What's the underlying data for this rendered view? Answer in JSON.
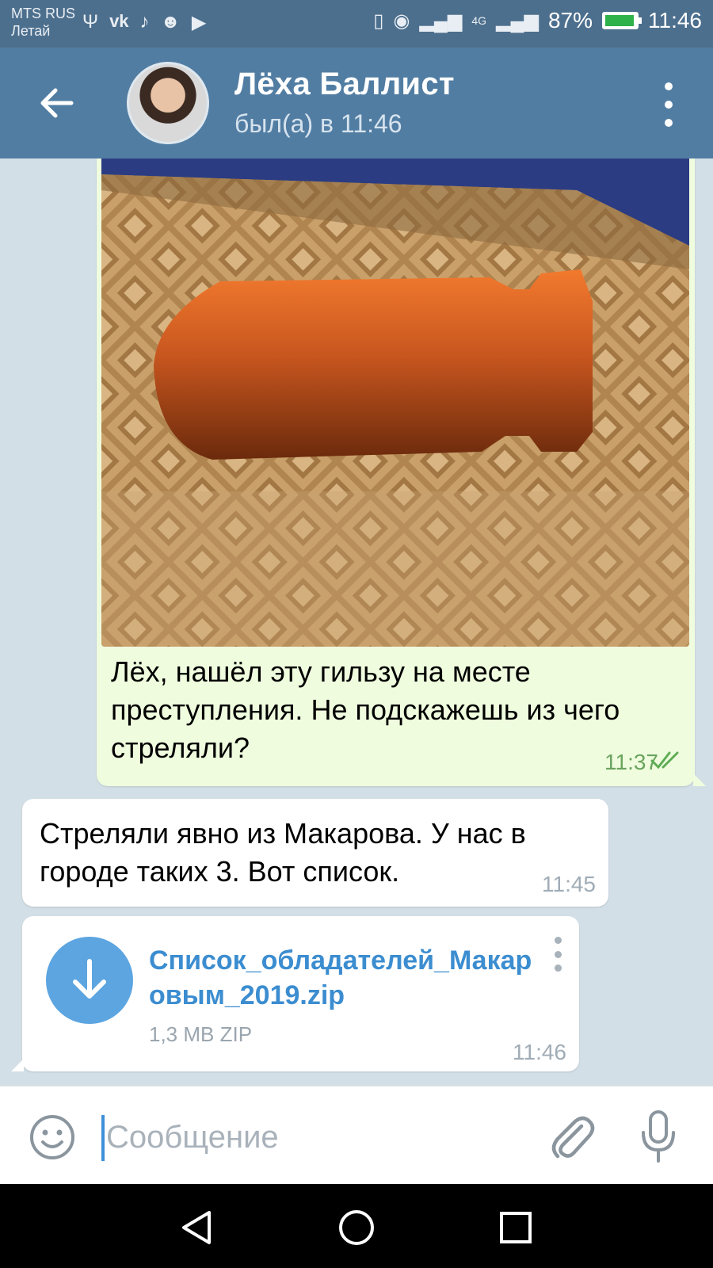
{
  "status_bar": {
    "carrier": "MTS RUS",
    "carrier_sub": "Летай",
    "battery": "87%",
    "time": "11:46",
    "network": "4G"
  },
  "header": {
    "title": "Лёха Баллист",
    "subtitle": "был(а) в 11:46"
  },
  "messages": {
    "outgoing": {
      "text": "Лёх, нашёл эту гильзу на месте преступления. Не подскажешь из чего стреляли?",
      "time": "11:37"
    },
    "incoming": {
      "text": "Стреляли явно из Макарова. У нас в городе таких 3. Вот список.",
      "time": "11:45"
    },
    "file": {
      "name": "Список_обладателей_Макаровым_2019.zip",
      "size": "1,3 MB ZIP",
      "time": "11:46"
    }
  },
  "input_bar": {
    "placeholder": "Сообщение"
  },
  "colors": {
    "header": "#527da3",
    "status_bar": "#4d6f8e",
    "outgoing_bubble": "#effdde",
    "link": "#3c8dd0",
    "download_button": "#5ca5e0"
  },
  "icons": {
    "back": "arrow-left-icon",
    "menu": "more-vertical-icon",
    "emoji": "smile-icon",
    "attach": "paperclip-icon",
    "mic": "microphone-icon",
    "download": "download-arrow-icon"
  }
}
